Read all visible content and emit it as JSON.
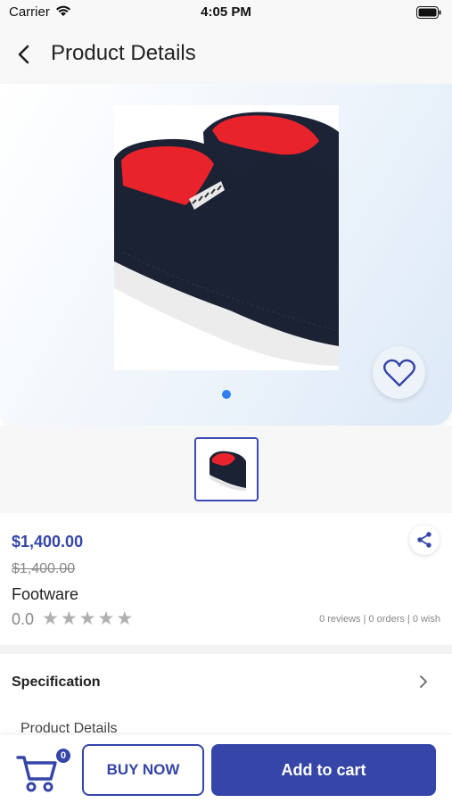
{
  "status_bar": {
    "carrier": "Carrier",
    "time": "4:05 PM"
  },
  "header": {
    "title": "Product Details",
    "back_icon": "chevron-left-icon"
  },
  "gallery": {
    "image_count": 1,
    "active_index": 0,
    "wishlisted": false,
    "wish_icon": "heart-outline-icon"
  },
  "product": {
    "price": "$1,400.00",
    "original_price": "$1,400.00",
    "name": "Footware",
    "rating": "0.0",
    "stars_filled": 0,
    "stars_total": 5,
    "stats": "0 reviews | 0 orders | 0 wish",
    "share_icon": "share-icon"
  },
  "specification": {
    "label": "Specification",
    "chevron_icon": "chevron-right-icon"
  },
  "details": {
    "label": "Product Details"
  },
  "actions": {
    "cart_count": "0",
    "buy_now": "BUY NOW",
    "add_to_cart": "Add to cart",
    "cart_icon": "cart-icon"
  },
  "colors": {
    "primary": "#3545a8",
    "dot_active": "#2f7ff0",
    "star_empty": "#b0b0b0"
  }
}
